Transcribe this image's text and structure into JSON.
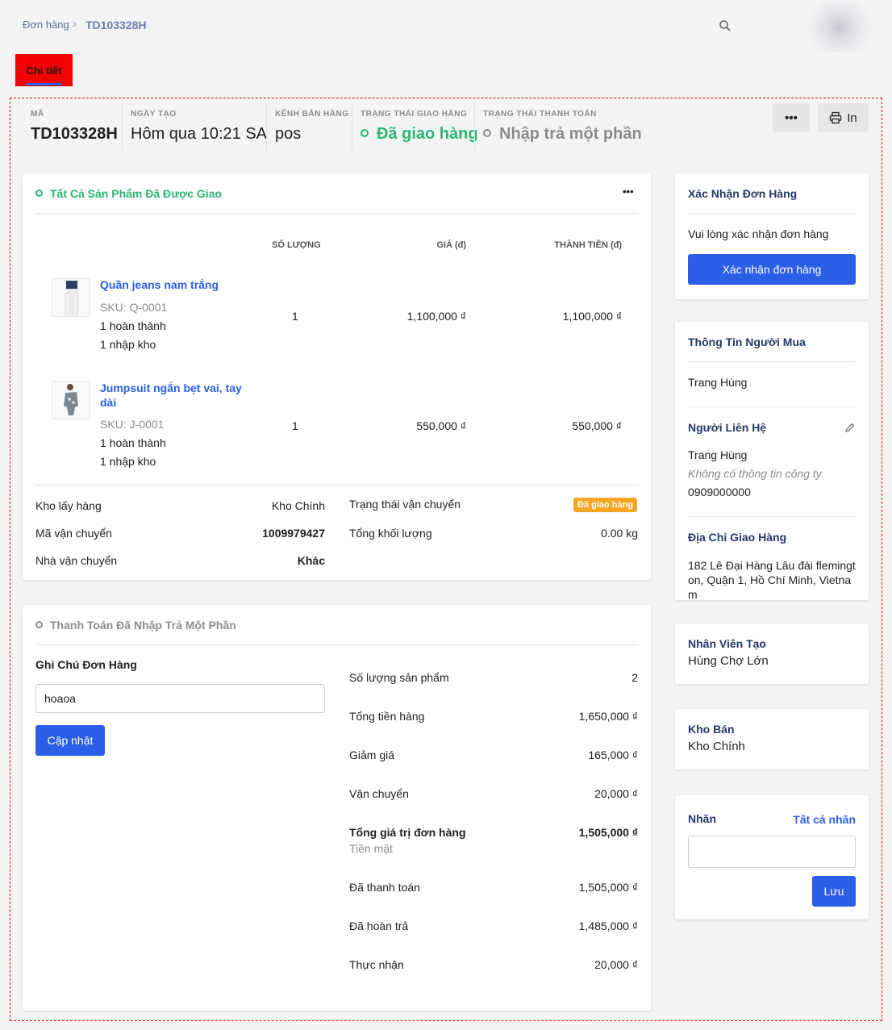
{
  "breadcrumb": {
    "root": "Đơn hàng",
    "separator": ">",
    "current": "TD103328H"
  },
  "tabs": [
    {
      "label": "Chi tiết"
    }
  ],
  "info": {
    "code": {
      "label": "MÃ",
      "value": "TD103328H"
    },
    "created": {
      "label": "NGÀY TẠO",
      "value": "Hôm qua 10:21 SA"
    },
    "channel": {
      "label": "KÊNH BÁN HÀNG",
      "value": "pos"
    },
    "delivery_status": {
      "label": "TRẠNG THÁI GIAO HÀNG",
      "value": "Đã giao hàng"
    },
    "payment_status": {
      "label": "TRẠNG THÁI THANH TOÁN",
      "value": "Nhập trả một phần"
    },
    "more_label": "•••",
    "print_label": "In"
  },
  "shipment": {
    "title": "Tất Cả Sản Phẩm Đã Được Giao",
    "more_label": "•••",
    "headers": {
      "qty": "SỐ LƯỢNG",
      "price": "GIÁ (đ)",
      "total": "THÀNH TIỀN (đ)"
    },
    "items": [
      {
        "name": "Quần jeans nam trắng",
        "sku": "SKU: Q-0001",
        "done": "1 hoàn thành",
        "stock": "1 nhập kho",
        "qty": "1",
        "price": "1,100,000 ₫",
        "total": "1,100,000 ₫"
      },
      {
        "name": "Jumpsuit ngắn bẹt vai, tay dài",
        "sku": "SKU: J-0001",
        "done": "1 hoàn thành",
        "stock": "1 nhập kho",
        "qty": "1",
        "price": "550,000 ₫",
        "total": "550,000 ₫"
      }
    ],
    "warehouse_label": "Kho lấy hàng",
    "warehouse_value": "Kho Chính",
    "tracking_label": "Mã vận chuyển",
    "tracking_value": "1009979427",
    "carrier_label": "Nhà vận chuyển",
    "carrier_value": "Khác",
    "ship_status_label": "Trạng thái vận chuyển",
    "ship_status_value": "Đã giao hàng",
    "weight_label": "Tổng khối lượng",
    "weight_value": "0.00 kg"
  },
  "payment": {
    "title": "Thanh Toán Đã Nhập Trả Một Phần",
    "note_label": "Ghi Chú Đơn Hàng",
    "note_value": "hoaoa",
    "update_label": "Cập nhật",
    "rows": [
      {
        "label": "Số lượng sản phẩm",
        "value": "2"
      },
      {
        "label": "Tổng tiền hàng",
        "value": "1,650,000 ₫"
      },
      {
        "label": "Giảm giá",
        "value": "165,000 ₫"
      },
      {
        "label": "Vận chuyển",
        "value": "20,000 ₫"
      },
      {
        "label": "Tổng giá trị đơn hàng",
        "value": "1,505,000 ₫",
        "sub": "Tiền mặt"
      },
      {
        "label": "Đã thanh toán",
        "value": "1,505,000 ₫"
      },
      {
        "label": "Đã hoàn trả",
        "value": "1,485,000 ₫"
      },
      {
        "label": "Thực nhận",
        "value": "20,000 ₫"
      }
    ]
  },
  "confirm": {
    "title": "Xác Nhận Đơn Hàng",
    "text": "Vui lòng xác nhận đơn hàng",
    "button": "Xác nhận đơn hàng"
  },
  "buyer": {
    "title": "Thông Tin Người Mua",
    "name": "Trang Hùng",
    "contact_title": "Người Liên Hệ",
    "contact_name": "Trang Hùng",
    "company": "Không có thông tin công ty",
    "phone": "0909000000",
    "address_title": "Địa Chỉ Giao Hàng",
    "address": "182 Lê Đại Hàng Lâu đài flemingt on, Quận 1, Hồ Chí Minh, Vietnam"
  },
  "staff": {
    "title": "Nhân Viên Tạo",
    "value": "Hùng Chợ Lớn"
  },
  "store": {
    "title": "Kho Bán",
    "value": "Kho Chính"
  },
  "tags": {
    "title": "Nhãn",
    "all_link": "Tất cả nhãn",
    "input_value": "",
    "save_label": "Lưu"
  },
  "colors": {
    "accent": "#2b5fe8",
    "success": "#2bb673",
    "warning": "#f5a623",
    "tab_bg": "#f40000",
    "navy": "#233a6b"
  }
}
